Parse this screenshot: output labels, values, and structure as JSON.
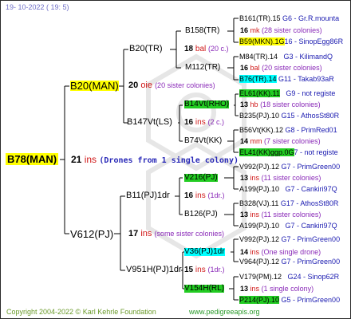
{
  "header": {
    "date": "19- 10-2022 (  19:  5)"
  },
  "footer": {
    "copyright": "Copyright 2004-2022 © Karl Kehrle Foundation",
    "url": "www.pedigreeapis.org"
  },
  "root": {
    "name": "B78(MAN)",
    "num": "21",
    "ins": "ins",
    "note": "(Drones from 1 single colony)"
  },
  "gen1": [
    {
      "name": "B20(MAN)",
      "num": "20",
      "ins": "oie",
      "note": "(20 sister colonies)"
    },
    {
      "name": "V612(PJ)",
      "num": "17",
      "ins": "ins",
      "note": "(some sister colonies)"
    }
  ],
  "gen2": [
    {
      "name": "B20(TR)",
      "num": "18",
      "ins": "bal",
      "note": "(20 c.)"
    },
    {
      "name": "B147Vt(LS)",
      "num": "16",
      "ins": "ins",
      "note": "(2 c.)"
    },
    {
      "name": "B11(PJ)1dr",
      "num": "16",
      "ins": "ins",
      "note": "(1dr.)"
    },
    {
      "name": "V951H(PJ)1dr",
      "num": "15",
      "ins": "ins",
      "note": "(1dr.)"
    }
  ],
  "gen3": [
    {
      "name": "B158(TR)",
      "num": "16",
      "ins": "mk",
      "note": "(28 sister colonies)"
    },
    {
      "name": "M112(TR)",
      "num": "16",
      "ins": "bal",
      "note": "(20 sister colonies)"
    },
    {
      "name": "B14Vt(RHO)",
      "num": "13",
      "ins": "hb",
      "note": "(18 sister colonies)"
    },
    {
      "name": "B74Vt(KK)",
      "num": "14",
      "ins": "mm",
      "note": "(7 sister colonies)"
    },
    {
      "name": "V216(PJ)",
      "num": "13",
      "ins": "ins",
      "note": "(11 sister colonies)"
    },
    {
      "name": "B126(PJ)",
      "num": "13",
      "ins": "ins",
      "note": "(11 sister colonies)"
    },
    {
      "name": "V36(PJ)1dr",
      "num": "14",
      "ins": "ins",
      "note": "(One single drone)"
    },
    {
      "name": "V154H(RL)",
      "num": "13",
      "ins": "ins",
      "note": "(1 single colony)"
    }
  ],
  "gen4": [
    {
      "name": "B161(TR).15",
      "g": "G6 - Gr.R.mounta"
    },
    {
      "name": "B59(MKN).1G",
      "g": "16 - SinopEgg86R"
    },
    {
      "name": "M84(TR).14",
      "g": "G3 - KilimandQ"
    },
    {
      "name": "B76(TR).14",
      "g": "G11 - Takab93aR"
    },
    {
      "name": "EL61(KK).11",
      "g": "G9 - not registe"
    },
    {
      "name": "B235(PJ).10",
      "g": "G15 - AthosSt80R"
    },
    {
      "name": "B56Vt(KK).12",
      "g": "G8 - PrimRed01"
    },
    {
      "name": "EL41(KK)ggp.0G",
      "g": "7 - not registe"
    },
    {
      "name": "V992(PJ).12",
      "g": "G7 - PrimGreen00"
    },
    {
      "name": "A199(PJ).10",
      "g": "G7 - Cankiri97Q"
    },
    {
      "name": "B328(VJ).11",
      "g": "G17 - AthosSt80R"
    },
    {
      "name": "A199(PJ).10",
      "g": "G7 - Cankiri97Q"
    },
    {
      "name": "V992(PJ).12",
      "g": "G7 - PrimGreen00"
    },
    {
      "name": "V964(PJ).12",
      "g": "G7 - PrimGreen00"
    },
    {
      "name": "V179(PM).12",
      "g": "G24 - Sinop62R"
    },
    {
      "name": "P214(PJ).10",
      "g": "G5 - PrimGreen00"
    }
  ]
}
